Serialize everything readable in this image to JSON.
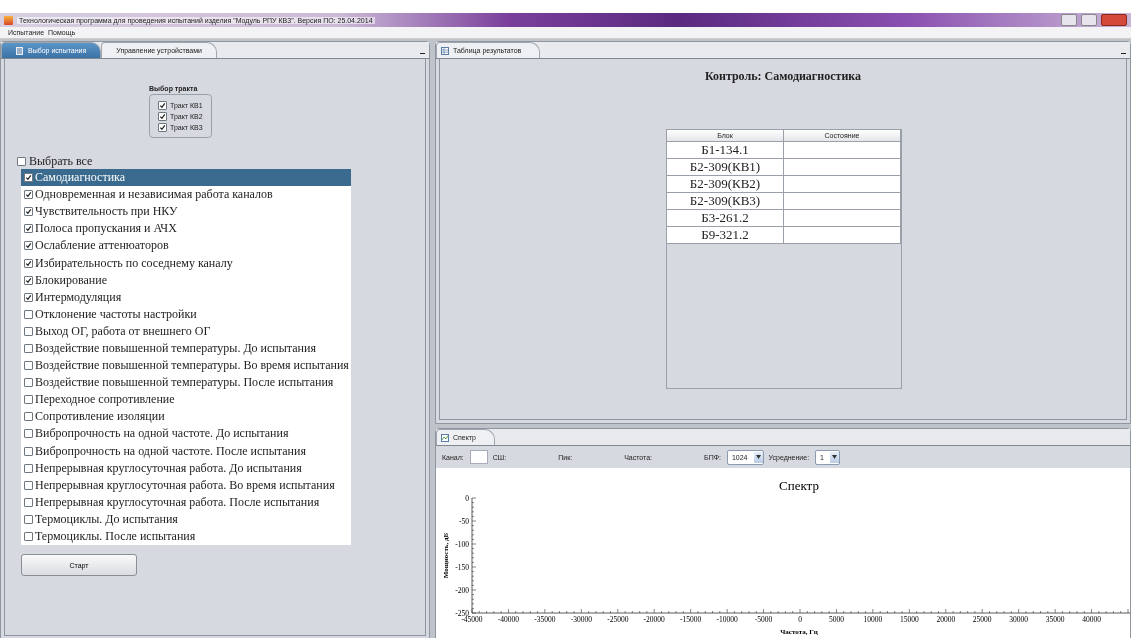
{
  "window": {
    "title": "Технологическая программа для проведения испытаний изделия \"Модуль РПУ КВ3\". Версия ПО: 25.04.2014"
  },
  "menu": [
    "Испытание",
    "Помощь"
  ],
  "left_panel": {
    "tabs": [
      {
        "label": "Выбор испытания",
        "selected": true
      },
      {
        "label": "Управление устройствами",
        "selected": false
      }
    ],
    "path_group": {
      "title": "Выбор тракта",
      "items": [
        {
          "label": "Тракт КВ1",
          "checked": true
        },
        {
          "label": "Тракт КВ2",
          "checked": true
        },
        {
          "label": "Тракт КВ3",
          "checked": true
        }
      ]
    },
    "select_all": {
      "label": "Выбрать все",
      "checked": false
    },
    "tests": [
      {
        "label": "Самодиагностика",
        "checked": true,
        "selected": true
      },
      {
        "label": "Одновременная и независимая работа каналов",
        "checked": true,
        "selected": false
      },
      {
        "label": "Чувствительность при НКУ",
        "checked": true,
        "selected": false
      },
      {
        "label": "Полоса пропускания и АЧХ",
        "checked": true,
        "selected": false
      },
      {
        "label": "Ослабление аттенюаторов",
        "checked": true,
        "selected": false
      },
      {
        "label": "Избирательность по соседнему каналу",
        "checked": true,
        "selected": false
      },
      {
        "label": "Блокирование",
        "checked": true,
        "selected": false
      },
      {
        "label": "Интермодуляция",
        "checked": true,
        "selected": false
      },
      {
        "label": "Отклонение частоты настройки",
        "checked": false,
        "selected": false
      },
      {
        "label": "Выход ОГ, работа от внешнего ОГ",
        "checked": false,
        "selected": false
      },
      {
        "label": "Воздействие повышенной температуры. До испытания",
        "checked": false,
        "selected": false
      },
      {
        "label": "Воздействие повышенной температуры. Во время испытания",
        "checked": false,
        "selected": false
      },
      {
        "label": "Воздействие повышенной температуры. После испытания",
        "checked": false,
        "selected": false
      },
      {
        "label": "Переходное сопротивление",
        "checked": false,
        "selected": false
      },
      {
        "label": "Сопротивление изоляции",
        "checked": false,
        "selected": false
      },
      {
        "label": "Вибропрочность на одной частоте. До испытания",
        "checked": false,
        "selected": false
      },
      {
        "label": "Вибропрочность на одной частоте. После испытания",
        "checked": false,
        "selected": false
      },
      {
        "label": "Непрерывная круглосуточная работа. До испытания",
        "checked": false,
        "selected": false
      },
      {
        "label": "Непрерывная круглосуточная работа. Во время испытания",
        "checked": false,
        "selected": false
      },
      {
        "label": "Непрерывная круглосуточная работа. После испытания",
        "checked": false,
        "selected": false
      },
      {
        "label": "Термоциклы. До испытания",
        "checked": false,
        "selected": false
      },
      {
        "label": "Термоциклы. После испытания",
        "checked": false,
        "selected": false
      }
    ],
    "start_button": "Старт"
  },
  "results_panel": {
    "tab": "Таблица результатов",
    "heading": "Контроль: Самодиагностика",
    "table": {
      "columns": [
        "Блок",
        "Состояние"
      ],
      "rows": [
        {
          "block": "Б1-134.1"
        },
        {
          "block": "Б2-309(КВ1)"
        },
        {
          "block": "Б2-309(КВ2)"
        },
        {
          "block": "Б2-309(КВ3)"
        },
        {
          "block": "Б3-261.2"
        },
        {
          "block": "Б9-321.2"
        }
      ]
    }
  },
  "spectrum_panel": {
    "tab": "Спектр",
    "toolbar": [
      {
        "kind": "label",
        "text": "Канал:"
      },
      {
        "kind": "input"
      },
      {
        "kind": "label",
        "text": "СШ:"
      },
      {
        "kind": "label",
        "text": "Пик:"
      },
      {
        "kind": "label",
        "text": "Частота:"
      },
      {
        "kind": "label",
        "text": "БПФ:"
      },
      {
        "kind": "select",
        "value": "1024"
      },
      {
        "kind": "label",
        "text": "Усреднение:"
      },
      {
        "kind": "select",
        "value": "1"
      }
    ],
    "chart_data": {
      "type": "line",
      "title": "Спектр",
      "xlabel": "Частота, Гц",
      "ylabel": "Мощность, дБ",
      "xlim": [
        -45000,
        45000
      ],
      "ylim": [
        -250,
        0
      ],
      "xticks": [
        -45000,
        -40000,
        -35000,
        -30000,
        -25000,
        -20000,
        -15000,
        -10000,
        -5000,
        0,
        5000,
        10000,
        15000,
        20000,
        25000,
        30000,
        35000,
        40000
      ],
      "yticks": [
        0,
        -50,
        -100,
        -150,
        -200,
        -250
      ]
    }
  }
}
